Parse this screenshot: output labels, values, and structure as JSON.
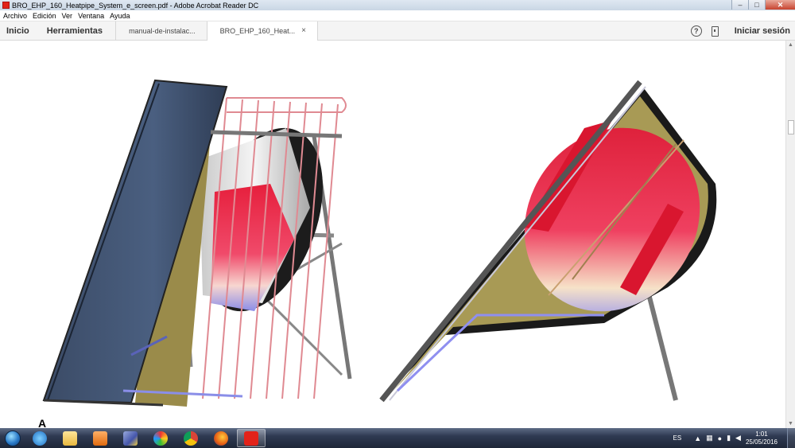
{
  "window": {
    "title": "BRO_EHP_160_Heatpipe_System_e_screen.pdf - Adobe Acrobat Reader DC",
    "minimize_glyph": "–",
    "maximize_glyph": "□",
    "close_glyph": "✕"
  },
  "menu": {
    "items": [
      "Archivo",
      "Edición",
      "Ver",
      "Ventana",
      "Ayuda"
    ]
  },
  "toolbar": {
    "home_label": "Inicio",
    "tools_label": "Herramientas",
    "tabs": [
      {
        "label": "manual-de-instalac..."
      },
      {
        "label": "BRO_EHP_160_Heat...",
        "close": "×"
      }
    ],
    "help_glyph": "?",
    "signin_label": "Iniciar sesión"
  },
  "document": {
    "text_fragment": "A"
  },
  "taskbar": {
    "apps": [
      "windows-start",
      "internet-explorer",
      "file-explorer",
      "media-player",
      "app-dynamics",
      "app-collaboration",
      "chrome",
      "firefox",
      "acrobat-reader"
    ],
    "language": "ES",
    "time": "1:01",
    "date": "25/05/2016"
  },
  "colors": {
    "acrobat_red": "#e2231a",
    "tab_bg": "#f4f4f4",
    "taskbar_bg": "#2f3a52"
  }
}
